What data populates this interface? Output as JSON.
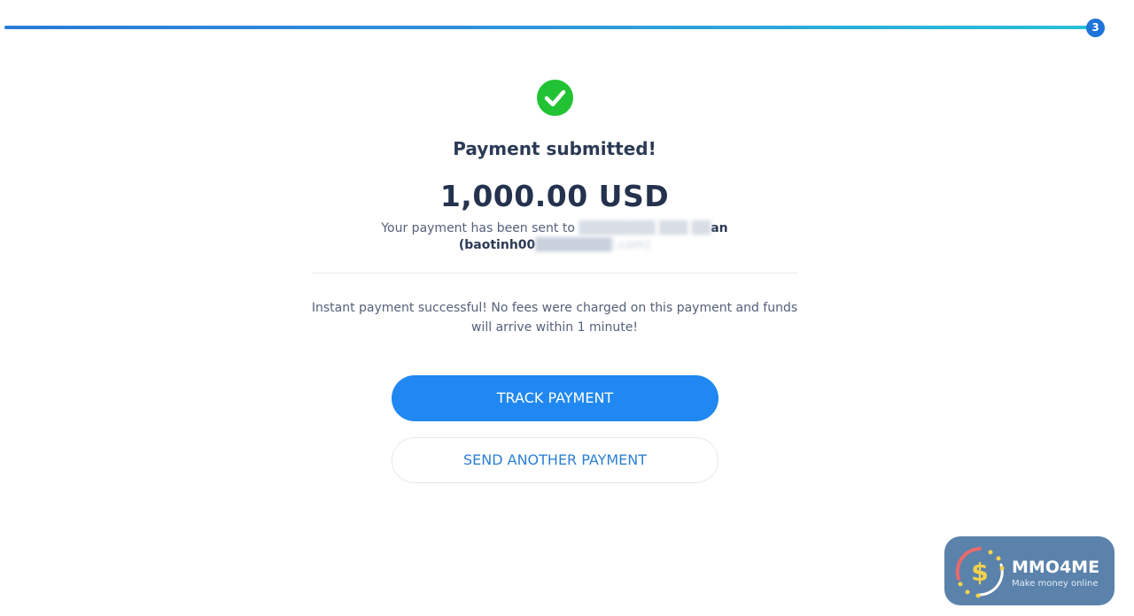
{
  "progress": {
    "step": "3",
    "fraction": 1.0
  },
  "status": {
    "icon": "check-circle-icon",
    "color": "#21c233",
    "title": "Payment submitted!"
  },
  "payment": {
    "amount": "1,000.00 USD",
    "sent_prefix": "Your payment has been sent to",
    "recipient_visible": "an",
    "email_visible": "(baotinh00",
    "email_tail": "l.com)"
  },
  "info": {
    "message": "Instant payment successful! No fees were charged on this payment and funds will arrive within 1 minute!"
  },
  "actions": {
    "track_label": "TRACK PAYMENT",
    "send_another_label": "SEND ANOTHER PAYMENT"
  },
  "colors": {
    "primary": "#2088f0",
    "text": "#2b3a55",
    "success": "#21c233"
  },
  "watermark": {
    "name": "MMO4ME",
    "tagline": "Make money online",
    "symbol": "$"
  }
}
